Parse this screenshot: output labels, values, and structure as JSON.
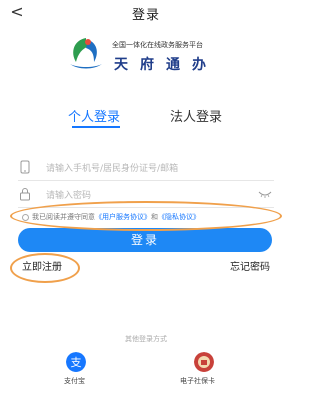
{
  "header": {
    "back_glyph": "<",
    "title": "登录"
  },
  "brand": {
    "subtitle": "全国一体化在线政务服务平台",
    "name": "天府通办",
    "logo_icon": "tianfu-logo-icon"
  },
  "tabs": [
    {
      "label": "个人登录",
      "active": true
    },
    {
      "label": "法人登录",
      "active": false
    }
  ],
  "form": {
    "phone_placeholder": "请输入手机号/居民身份证号/邮箱",
    "password_placeholder": "请输入密码",
    "phone_icon": "phone-icon",
    "password_icon": "lock-icon",
    "visibility_icon": "eye-closed-icon"
  },
  "agreement": {
    "prefix": "我已阅读并遵守同意",
    "user_agreement": "《用户服务协议》",
    "and": "和",
    "privacy_policy": "《隐私协议》"
  },
  "buttons": {
    "login": "登录",
    "register": "立即注册",
    "forgot": "忘记密码"
  },
  "alt_login": {
    "title": "其他登录方式",
    "options": [
      {
        "label": "支付宝",
        "icon": "alipay-icon"
      },
      {
        "label": "电子社保卡",
        "icon": "social-security-card-icon"
      }
    ]
  },
  "colors": {
    "accent": "#1677ff",
    "button": "#1e88f5",
    "annotation": "#f0a04b",
    "brand_text": "#1f3d8a"
  }
}
